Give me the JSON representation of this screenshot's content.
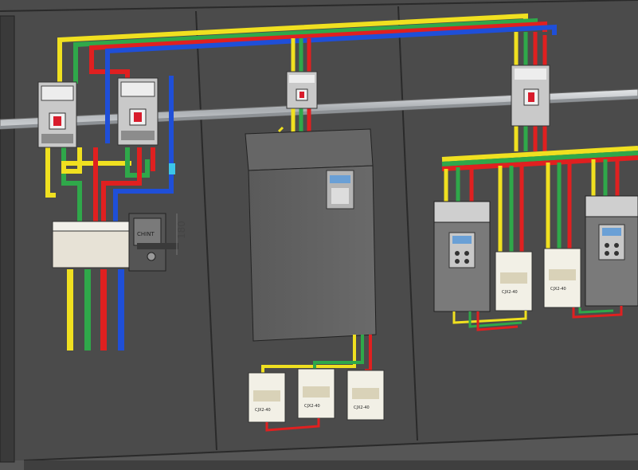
{
  "drawing": {
    "dimension_text": "180",
    "switch_label": "CHINT",
    "contactor_labels": [
      "CJX2-40",
      "CJX2-40",
      "CJX2-40",
      "CJX2-40",
      "CJX2-40"
    ]
  },
  "colors": {
    "background": "#5b5b5b",
    "panel": "#4a4a4a",
    "rail": "#b8bcbf",
    "phase_yellow": "#f0e020",
    "phase_green": "#2fa84a",
    "phase_red": "#e02020",
    "phase_blue": "#1f4fd8",
    "device_gray": "#d6d6d6",
    "contactor_white": "#f2f0e6"
  }
}
